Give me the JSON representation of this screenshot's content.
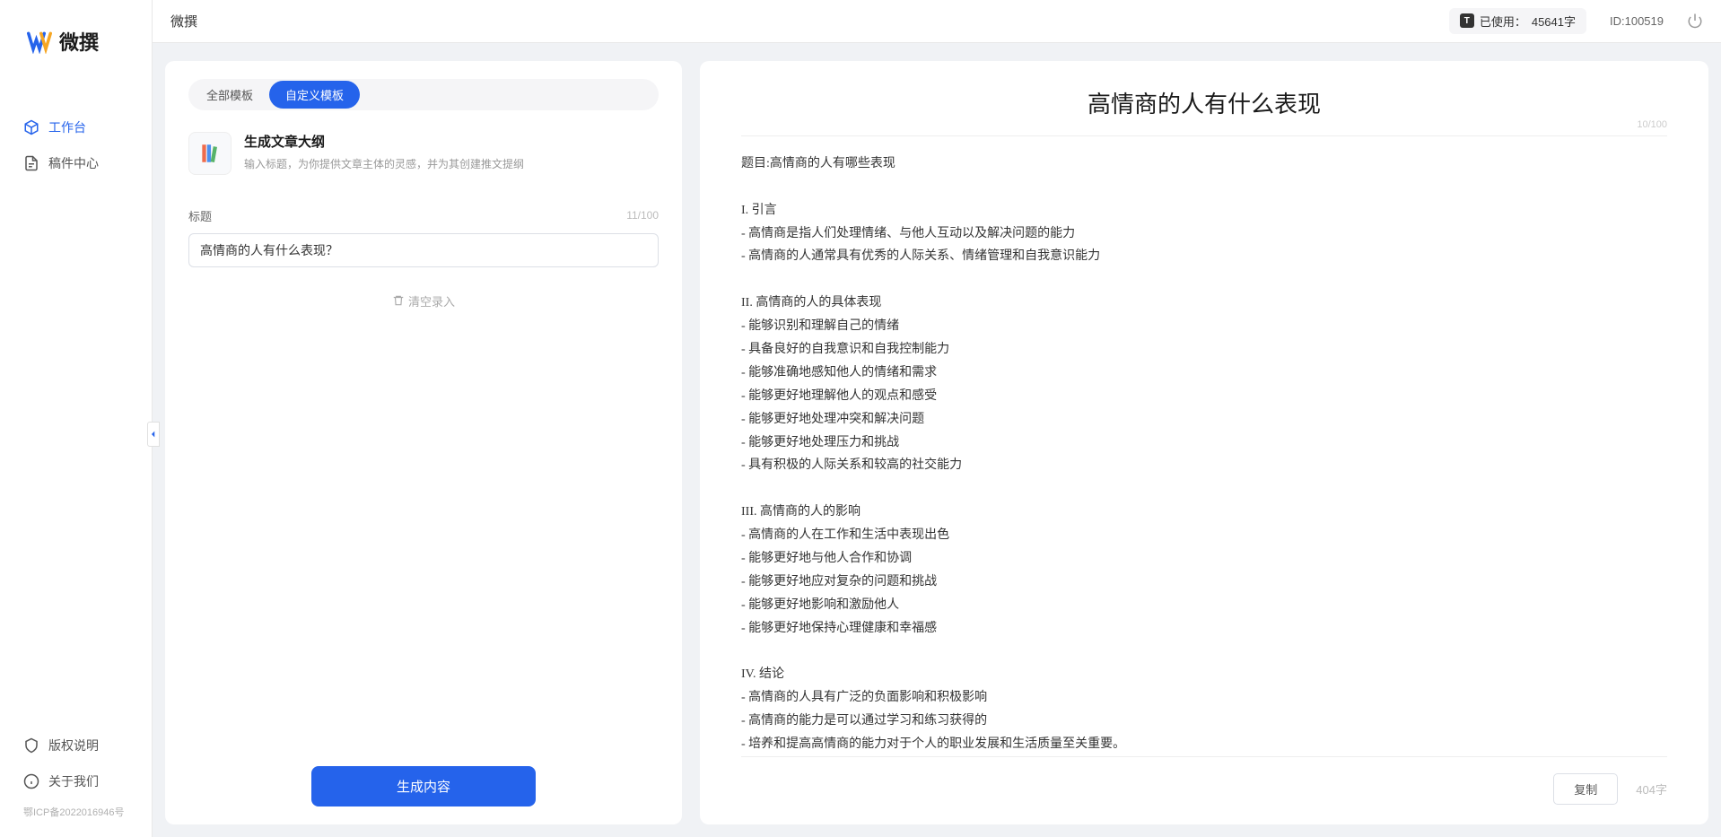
{
  "app": {
    "name": "微撰"
  },
  "sidebar": {
    "logo_text": "微撰",
    "nav": [
      {
        "label": "工作台",
        "active": true
      },
      {
        "label": "稿件中心",
        "active": false
      }
    ],
    "footer_nav": [
      {
        "label": "版权说明"
      },
      {
        "label": "关于我们"
      }
    ],
    "icp": "鄂ICP备2022016946号"
  },
  "topbar": {
    "title": "微撰",
    "usage_label": "已使用：",
    "usage_value": "45641字",
    "usage_badge": "T",
    "user_id": "ID:100519"
  },
  "left": {
    "tabs": [
      {
        "label": "全部模板",
        "active": false
      },
      {
        "label": "自定义模板",
        "active": true
      }
    ],
    "template": {
      "title": "生成文章大纲",
      "desc": "输入标题，为你提供文章主体的灵感，并为其创建推文提纲"
    },
    "field": {
      "label": "标题",
      "count": "11/100",
      "value": "高情商的人有什么表现？"
    },
    "clear_label": "清空录入",
    "generate_label": "生成内容"
  },
  "right": {
    "title": "高情商的人有什么表现",
    "title_count": "10/100",
    "body": "题目:高情商的人有哪些表现\n\nI. 引言\n- 高情商是指人们处理情绪、与他人互动以及解决问题的能力\n- 高情商的人通常具有优秀的人际关系、情绪管理和自我意识能力\n\nII. 高情商的人的具体表现\n- 能够识别和理解自己的情绪\n- 具备良好的自我意识和自我控制能力\n- 能够准确地感知他人的情绪和需求\n- 能够更好地理解他人的观点和感受\n- 能够更好地处理冲突和解决问题\n- 能够更好地处理压力和挑战\n- 具有积极的人际关系和较高的社交能力\n\nIII. 高情商的人的影响\n- 高情商的人在工作和生活中表现出色\n- 能够更好地与他人合作和协调\n- 能够更好地应对复杂的问题和挑战\n- 能够更好地影响和激励他人\n- 能够更好地保持心理健康和幸福感\n\nIV. 结论\n- 高情商的人具有广泛的负面影响和积极影响\n- 高情商的能力是可以通过学习和练习获得的\n- 培养和提高高情商的能力对于个人的职业发展和生活质量至关重要。",
    "copy_label": "复制",
    "word_count": "404字"
  }
}
